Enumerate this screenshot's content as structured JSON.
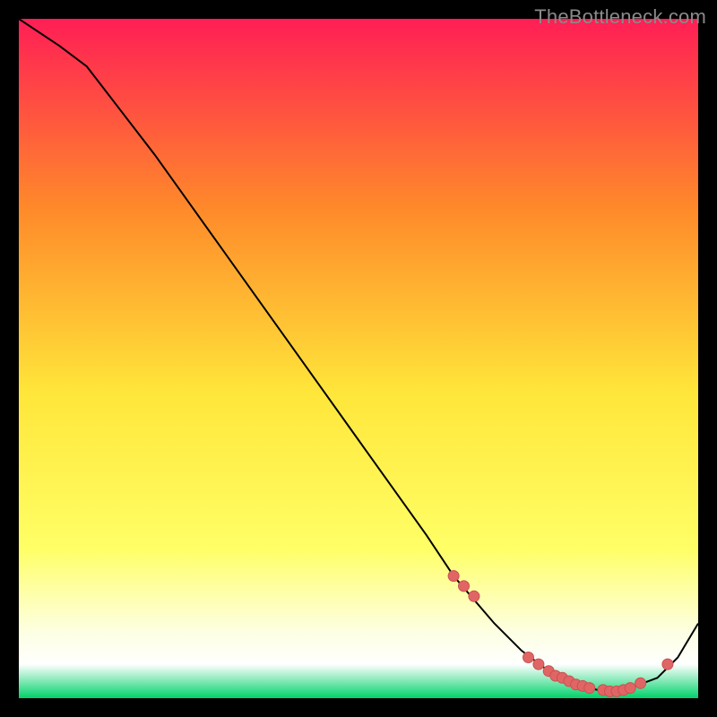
{
  "watermark": "TheBottleneck.com",
  "colors": {
    "background": "#000000",
    "watermark_text": "#8a8a8a",
    "curve": "#000000",
    "marker_fill": "#e06666",
    "marker_stroke": "#cc4f4f",
    "gradient_top": "#ff1e55",
    "gradient_mid_upper": "#ff8a2a",
    "gradient_mid": "#ffe63a",
    "gradient_low_yellow": "#ffff66",
    "gradient_pale": "#fdffe0",
    "gradient_white": "#ffffff",
    "gradient_green": "#00d26a"
  },
  "chart_data": {
    "type": "line",
    "title": "",
    "xlabel": "",
    "ylabel": "",
    "xlim": [
      0,
      100
    ],
    "ylim": [
      0,
      100
    ],
    "grid": false,
    "legend": null,
    "series": [
      {
        "name": "bottleneck-curve",
        "x": [
          0,
          6,
          10,
          20,
          30,
          40,
          50,
          60,
          64,
          70,
          74,
          78,
          82,
          86,
          90,
          94,
          97,
          100
        ],
        "y": [
          100,
          96,
          93,
          80,
          66,
          52,
          38,
          24,
          18,
          11,
          7,
          4,
          2,
          1,
          1.5,
          3,
          6,
          11
        ]
      }
    ],
    "markers": {
      "name": "highlighted-points",
      "x": [
        64,
        65.5,
        67,
        75,
        76.5,
        78,
        79,
        80,
        81,
        82,
        83,
        84,
        86,
        87,
        88,
        89,
        90,
        91.5,
        95.5
      ],
      "y": [
        18,
        16.5,
        15,
        6,
        5,
        4,
        3.3,
        3,
        2.5,
        2,
        1.8,
        1.5,
        1.2,
        1,
        1,
        1.2,
        1.5,
        2.2,
        5
      ]
    }
  }
}
